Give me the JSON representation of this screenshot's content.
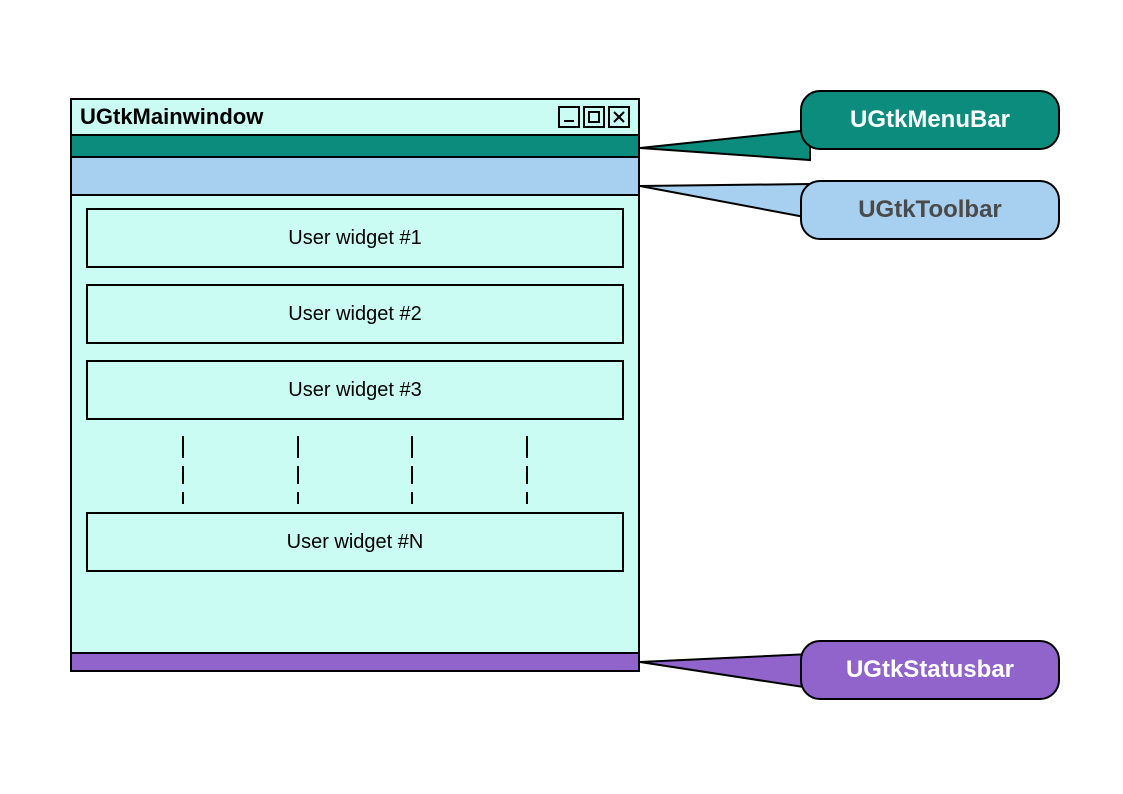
{
  "window": {
    "title": "UGtkMainwindow",
    "widgets": [
      "User widget #1",
      "User widget #2",
      "User widget #3",
      "User widget #N"
    ]
  },
  "callouts": {
    "menubar": "UGtkMenuBar",
    "toolbar": "UGtkToolbar",
    "statusbar": "UGtkStatusbar"
  },
  "colors": {
    "window_bg": "#cbfcf4",
    "menubar": "#0c8c7c",
    "toolbar": "#a6cff0",
    "statusbar": "#9164cc"
  }
}
